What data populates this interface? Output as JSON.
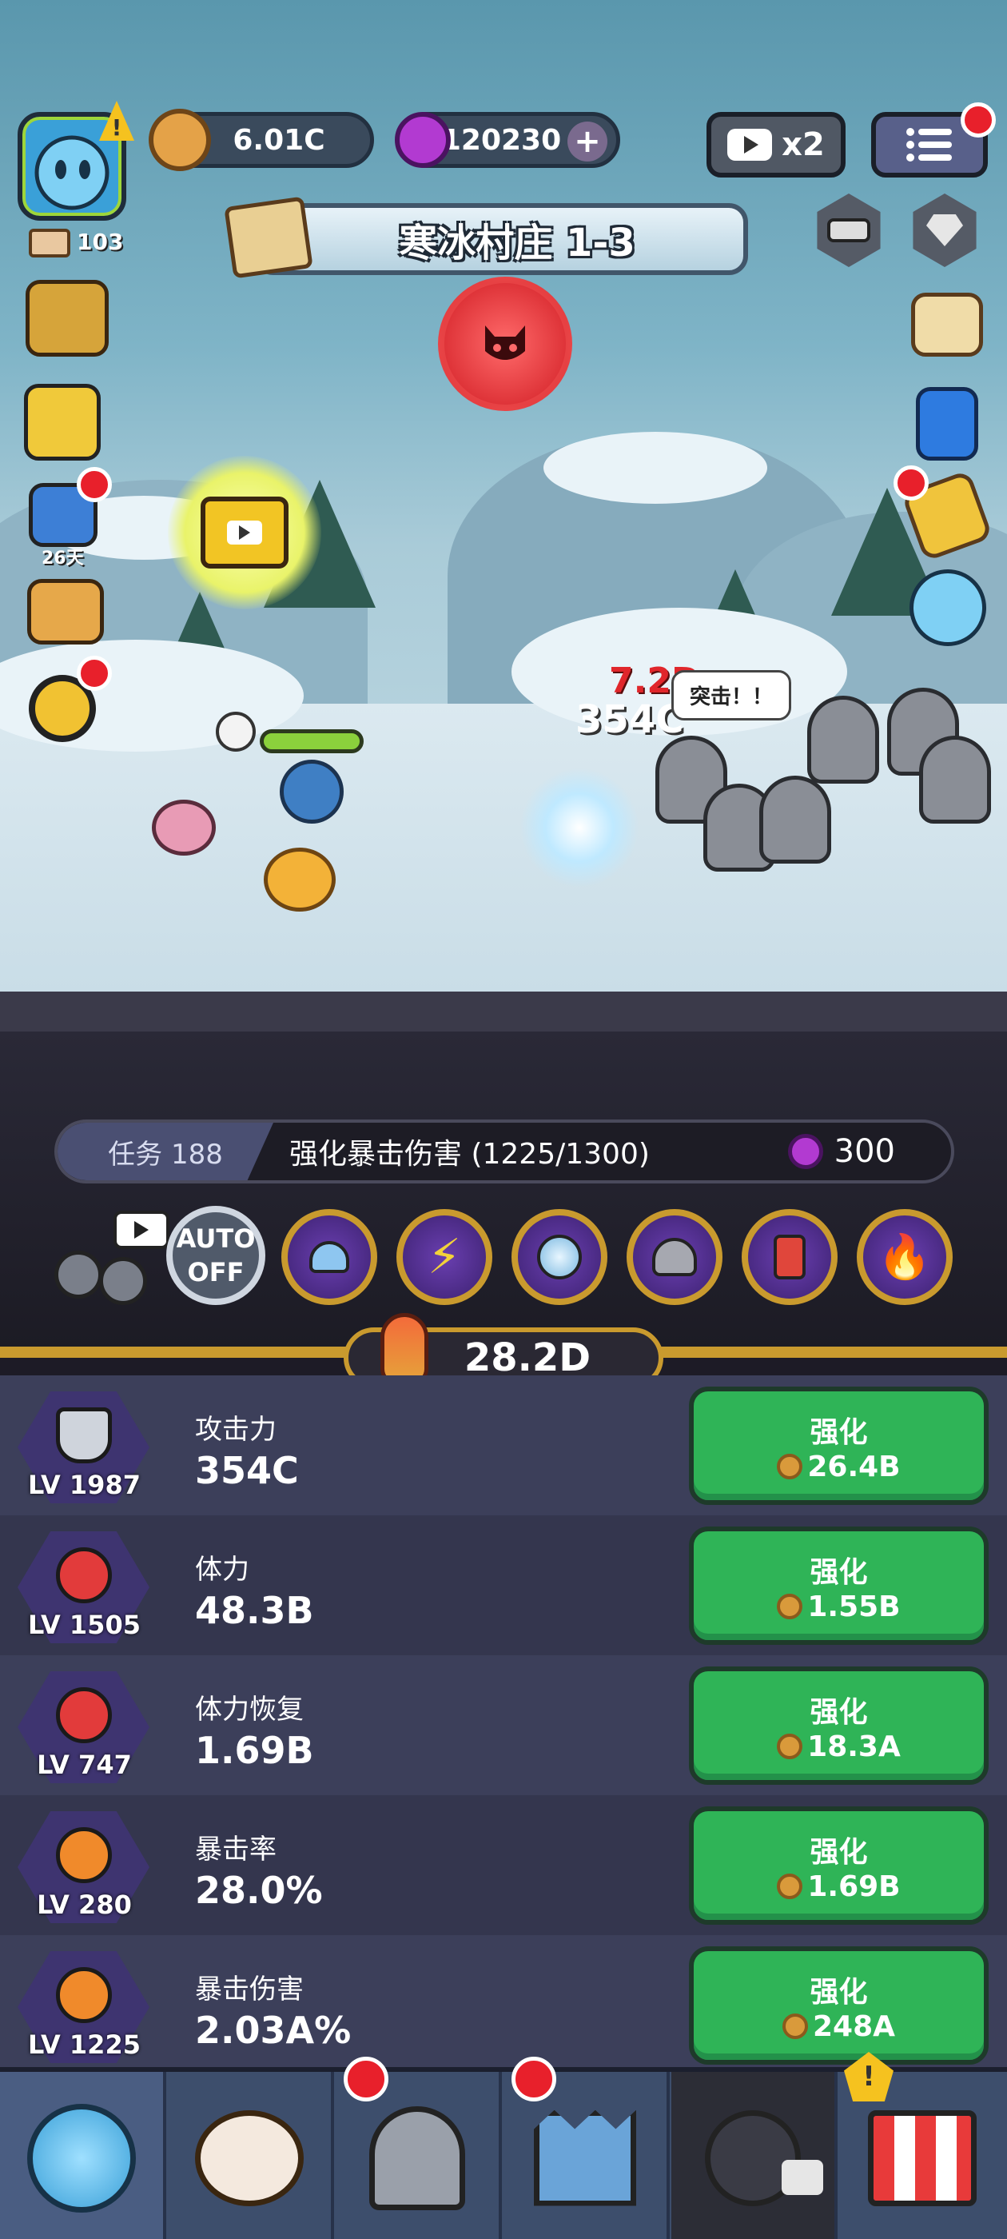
{
  "hud": {
    "player_count": "103",
    "gold": "6.01C",
    "gems": "120230",
    "ad_multiplier": "x2",
    "stage_title": "寒冰村庄 1-3",
    "event_days": "26天"
  },
  "battle": {
    "crit_damage": "7.2D",
    "hit_damage": "354C",
    "speech": "突击！！"
  },
  "mission": {
    "tag": "任务 188",
    "text": "强化暴击伤害 (1225/1300)",
    "reward": "300"
  },
  "auto": {
    "line1": "AUTO",
    "line2": "OFF"
  },
  "power": "28.2D",
  "stats": [
    {
      "level": "LV 1987",
      "name": "攻击力",
      "value": "354C",
      "button": "强化",
      "cost": "26.4B",
      "icon": "sword-icon"
    },
    {
      "level": "LV 1505",
      "name": "体力",
      "value": "48.3B",
      "button": "强化",
      "cost": "1.55B",
      "icon": "heart-icon"
    },
    {
      "level": "LV 747",
      "name": "体力恢复",
      "value": "1.69B",
      "button": "强化",
      "cost": "18.3A",
      "icon": "heart-regen-icon"
    },
    {
      "level": "LV 280",
      "name": "暴击率",
      "value": "28.0%",
      "button": "强化",
      "cost": "1.69B",
      "icon": "crit-rate-icon"
    },
    {
      "level": "LV 1225",
      "name": "暴击伤害",
      "value": "2.03A%",
      "button": "强化",
      "cost": "248A",
      "icon": "crit-damage-icon"
    }
  ],
  "colors": {
    "upgrade_button": "#2fb457",
    "gold_trim": "#c99a2e",
    "alert": "#e8202b"
  }
}
